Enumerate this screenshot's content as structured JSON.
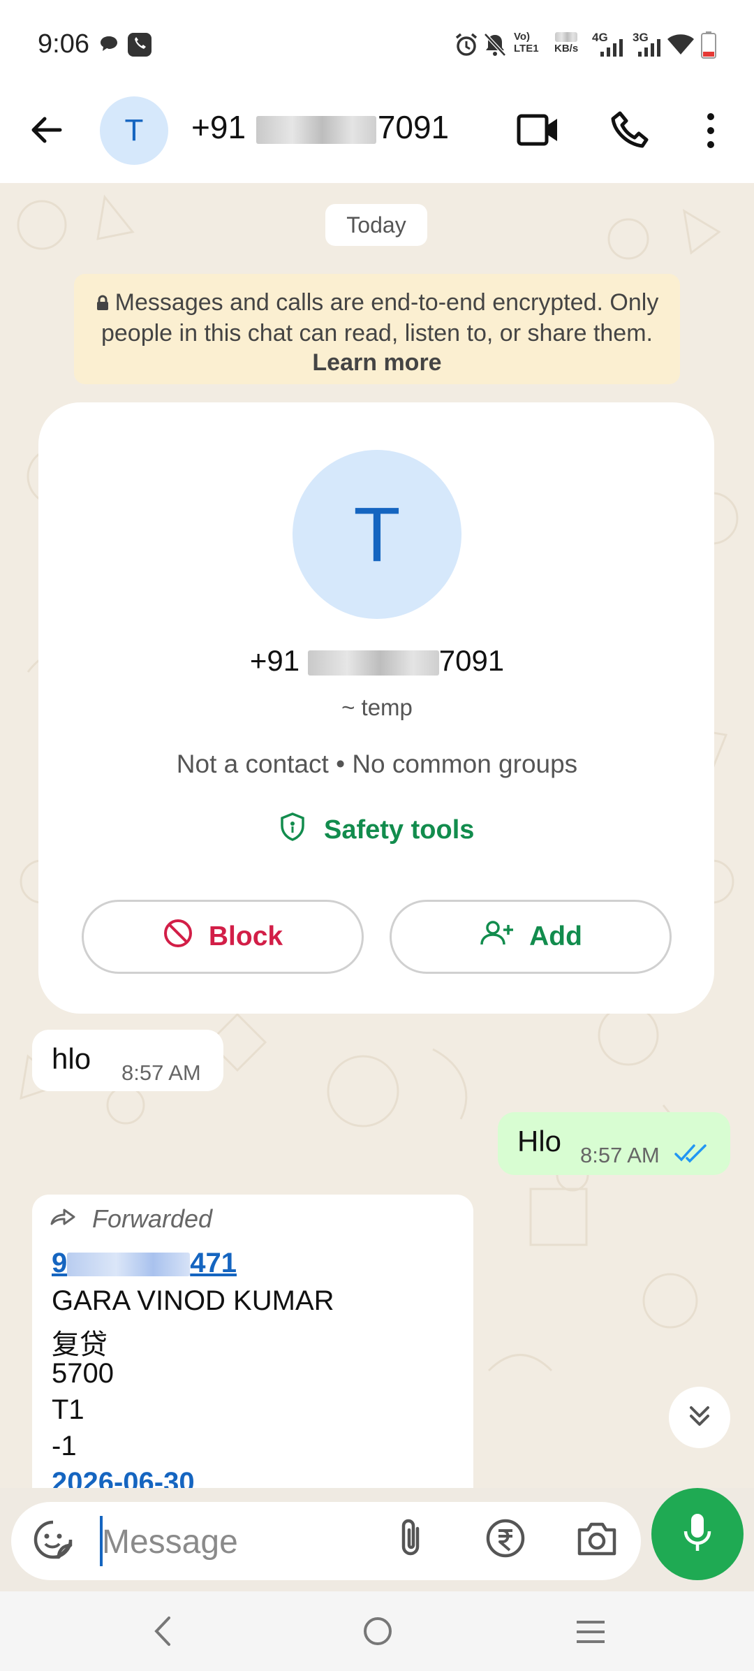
{
  "status_bar": {
    "time": "9:06",
    "lte_label": "LTE1",
    "speed_label": "KB/s",
    "net1": "4G",
    "net2": "3G"
  },
  "header": {
    "avatar_letter": "T",
    "phone_prefix": "+91",
    "phone_suffix": "7091"
  },
  "chat": {
    "date_pill": "Today",
    "encryption_notice": "Messages and calls are end-to-end encrypted. Only people in this chat can read, listen to, or share them.",
    "learn_more": "Learn more",
    "contact_card": {
      "avatar_letter": "T",
      "phone_prefix": "+91",
      "phone_suffix": "7091",
      "name": "~ temp",
      "info": "Not a contact • No common groups",
      "safety_tools": "Safety tools",
      "block_label": "Block",
      "add_label": "Add"
    },
    "messages": [
      {
        "direction": "in",
        "text": "hlo",
        "time": "8:57 AM"
      },
      {
        "direction": "out",
        "text": "Hlo",
        "time": "8:57 AM",
        "status": "read"
      }
    ],
    "forwarded": {
      "label": "Forwarded",
      "link_prefix": "9",
      "link_suffix": "471",
      "lines": [
        "GARA VINOD KUMAR",
        "复贷",
        "5700",
        "T1",
        "-1"
      ],
      "date_link": "2026-06-30"
    }
  },
  "composer": {
    "placeholder": "Message"
  },
  "colors": {
    "accent_green": "#1faa53",
    "block_red": "#d21e47",
    "chat_bg": "#f2ece2",
    "outgoing_bubble": "#d8fdd2",
    "link_blue": "#1565c0"
  }
}
